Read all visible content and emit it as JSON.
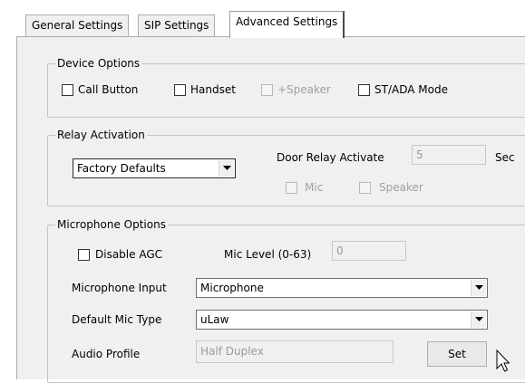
{
  "tabs": [
    {
      "label": "General Settings"
    },
    {
      "label": "SIP Settings"
    },
    {
      "label": "Advanced Settings",
      "active": true
    }
  ],
  "device_options": {
    "title": "Device Options",
    "call_button": {
      "label": "Call Button",
      "checked": false
    },
    "handset": {
      "label": "Handset",
      "checked": false
    },
    "speaker": {
      "label": "+Speaker",
      "checked": false,
      "disabled": true
    },
    "st_ada": {
      "label": "ST/ADA Mode",
      "checked": false
    }
  },
  "relay_activation": {
    "title": "Relay Activation",
    "mode_value": "Factory Defaults",
    "door_relay_label": "Door Relay Activate",
    "door_relay_value": "5",
    "unit": "Sec",
    "mic": {
      "label": "Mic",
      "checked": false,
      "disabled": true
    },
    "speaker": {
      "label": "Speaker",
      "checked": false,
      "disabled": true
    }
  },
  "microphone_options": {
    "title": "Microphone Options",
    "disable_agc": {
      "label": "Disable AGC",
      "checked": false
    },
    "mic_level_label": "Mic Level (0-63)",
    "mic_level_value": "0",
    "mic_input_label": "Microphone Input",
    "mic_input_value": "Microphone",
    "mic_type_label": "Default Mic Type",
    "mic_type_value": "uLaw",
    "audio_profile_label": "Audio Profile",
    "audio_profile_value": "Half Duplex",
    "set_label": "Set"
  }
}
